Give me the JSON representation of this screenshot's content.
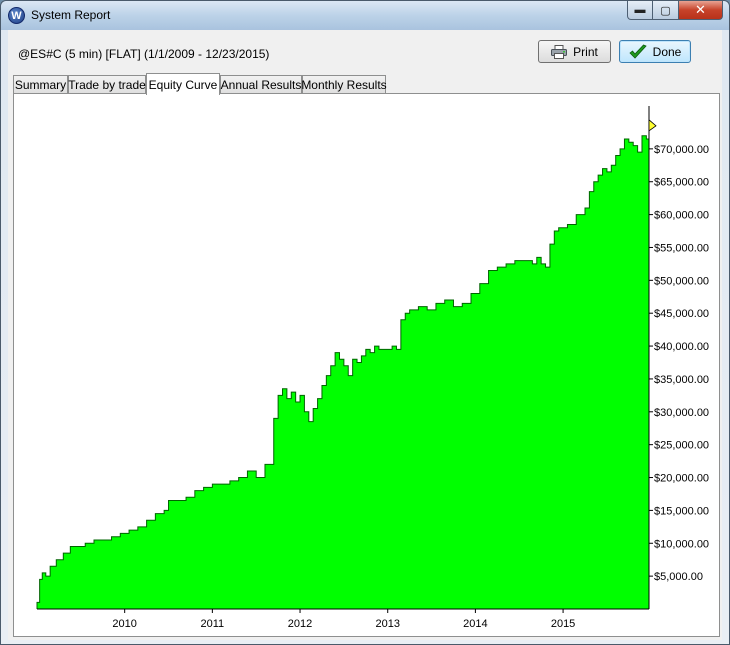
{
  "window": {
    "title": "System Report",
    "icon": "W",
    "controls": {
      "minimize": "▬",
      "maximize": "▢",
      "close": "✕"
    }
  },
  "header": {
    "symbol_info": "@ES#C (5 min) [FLAT]  (1/1/2009 - 12/23/2015)"
  },
  "buttons": {
    "print_label": "Print",
    "done_label": "Done"
  },
  "tabs": [
    {
      "label": "Summary",
      "active": false
    },
    {
      "label": "Trade by trade",
      "active": false
    },
    {
      "label": "Equity Curve",
      "active": true
    },
    {
      "label": "Annual Results",
      "active": false
    },
    {
      "label": "Monthly Results",
      "active": false
    }
  ],
  "colors": {
    "fill": "#00ff00",
    "line": "#006400"
  },
  "chart_data": {
    "type": "area",
    "title": "",
    "xlabel": "",
    "ylabel": "",
    "ylim": [
      0,
      75000
    ],
    "xlim": [
      2009.0,
      2015.98
    ],
    "ytick_labels": [
      "$5,000.00",
      "$10,000.00",
      "$15,000.00",
      "$20,000.00",
      "$25,000.00",
      "$30,000.00",
      "$35,000.00",
      "$40,000.00",
      "$45,000.00",
      "$50,000.00",
      "$55,000.00",
      "$60,000.00",
      "$65,000.00",
      "$70,000.00"
    ],
    "ytick_values": [
      5000,
      10000,
      15000,
      20000,
      25000,
      30000,
      35000,
      40000,
      45000,
      50000,
      55000,
      60000,
      65000,
      70000
    ],
    "xtick_labels": [
      "2010",
      "2011",
      "2012",
      "2013",
      "2014",
      "2015"
    ],
    "xtick_values": [
      2010,
      2011,
      2012,
      2013,
      2014,
      2015
    ],
    "grid": false,
    "legend": "none",
    "series": [
      {
        "x": [
          2009.0,
          2009.03,
          2009.06,
          2009.1,
          2009.15,
          2009.22,
          2009.3,
          2009.38,
          2009.45,
          2009.55,
          2009.65,
          2009.75,
          2009.85,
          2009.95,
          2010.05,
          2010.15,
          2010.25,
          2010.35,
          2010.45,
          2010.5,
          2010.6,
          2010.7,
          2010.8,
          2010.9,
          2011.0,
          2011.1,
          2011.2,
          2011.3,
          2011.4,
          2011.5,
          2011.6,
          2011.7,
          2011.75,
          2011.8,
          2011.85,
          2011.9,
          2011.95,
          2012.0,
          2012.05,
          2012.1,
          2012.15,
          2012.2,
          2012.25,
          2012.3,
          2012.35,
          2012.4,
          2012.45,
          2012.5,
          2012.55,
          2012.6,
          2012.65,
          2012.7,
          2012.75,
          2012.8,
          2012.85,
          2012.9,
          2012.95,
          2013.0,
          2013.05,
          2013.1,
          2013.15,
          2013.2,
          2013.25,
          2013.35,
          2013.45,
          2013.55,
          2013.65,
          2013.75,
          2013.85,
          2013.95,
          2014.05,
          2014.15,
          2014.25,
          2014.35,
          2014.45,
          2014.55,
          2014.65,
          2014.7,
          2014.75,
          2014.8,
          2014.85,
          2014.9,
          2014.95,
          2015.05,
          2015.15,
          2015.25,
          2015.3,
          2015.35,
          2015.4,
          2015.45,
          2015.5,
          2015.55,
          2015.6,
          2015.65,
          2015.7,
          2015.75,
          2015.8,
          2015.85,
          2015.9,
          2015.95,
          2015.98
        ],
        "y": [
          1000,
          4500,
          5500,
          5000,
          6500,
          7500,
          8500,
          9500,
          9500,
          10000,
          10500,
          10500,
          11000,
          11500,
          12000,
          12500,
          13500,
          14500,
          15000,
          16500,
          16500,
          17000,
          18000,
          18500,
          19000,
          19000,
          19500,
          20000,
          21000,
          20000,
          22000,
          29000,
          32500,
          33500,
          32000,
          33000,
          31500,
          32500,
          30000,
          28500,
          30500,
          32000,
          34000,
          35500,
          37000,
          39000,
          38000,
          37000,
          35500,
          38000,
          37500,
          38500,
          39500,
          39000,
          40000,
          39500,
          39500,
          39500,
          40000,
          39500,
          44000,
          45000,
          45500,
          46000,
          45500,
          46500,
          47000,
          46000,
          46500,
          48000,
          49500,
          51500,
          52000,
          52500,
          53000,
          53000,
          52500,
          53500,
          52500,
          52000,
          55500,
          57500,
          58000,
          58500,
          60000,
          61000,
          63500,
          65000,
          66000,
          67000,
          66500,
          67500,
          69000,
          70000,
          71500,
          71000,
          70500,
          69500,
          72000,
          71500,
          73500
        ]
      }
    ]
  }
}
